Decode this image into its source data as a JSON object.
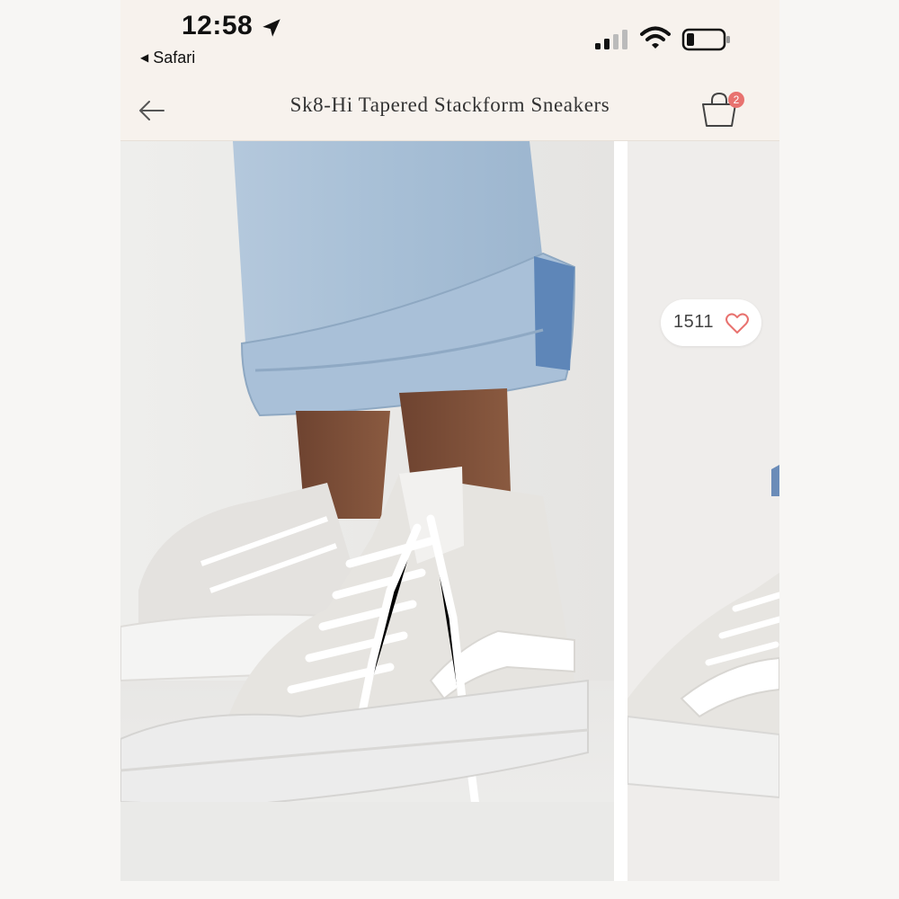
{
  "status_bar": {
    "time": "12:58",
    "back_app_label": "Safari",
    "icons": [
      "location-arrow-icon",
      "cellular-signal-icon",
      "wifi-icon",
      "battery-icon"
    ]
  },
  "nav": {
    "back_icon": "back-arrow-icon",
    "title": "Sk8-Hi Tapered Stackform Sneakers",
    "bag_icon": "shopping-bag-icon",
    "bag_count": "2"
  },
  "gallery": {
    "main_image": "photo of person in cuffed light-wash jeans wearing white/grey high-top platform sneakers",
    "next_image": "partial photo of the same sneakers from another angle",
    "likes": "1511",
    "like_icon": "heart-outline-icon"
  },
  "colors": {
    "header_bg": "#f7f2ed",
    "badge": "#e8726f",
    "heart": "#e8726f"
  }
}
